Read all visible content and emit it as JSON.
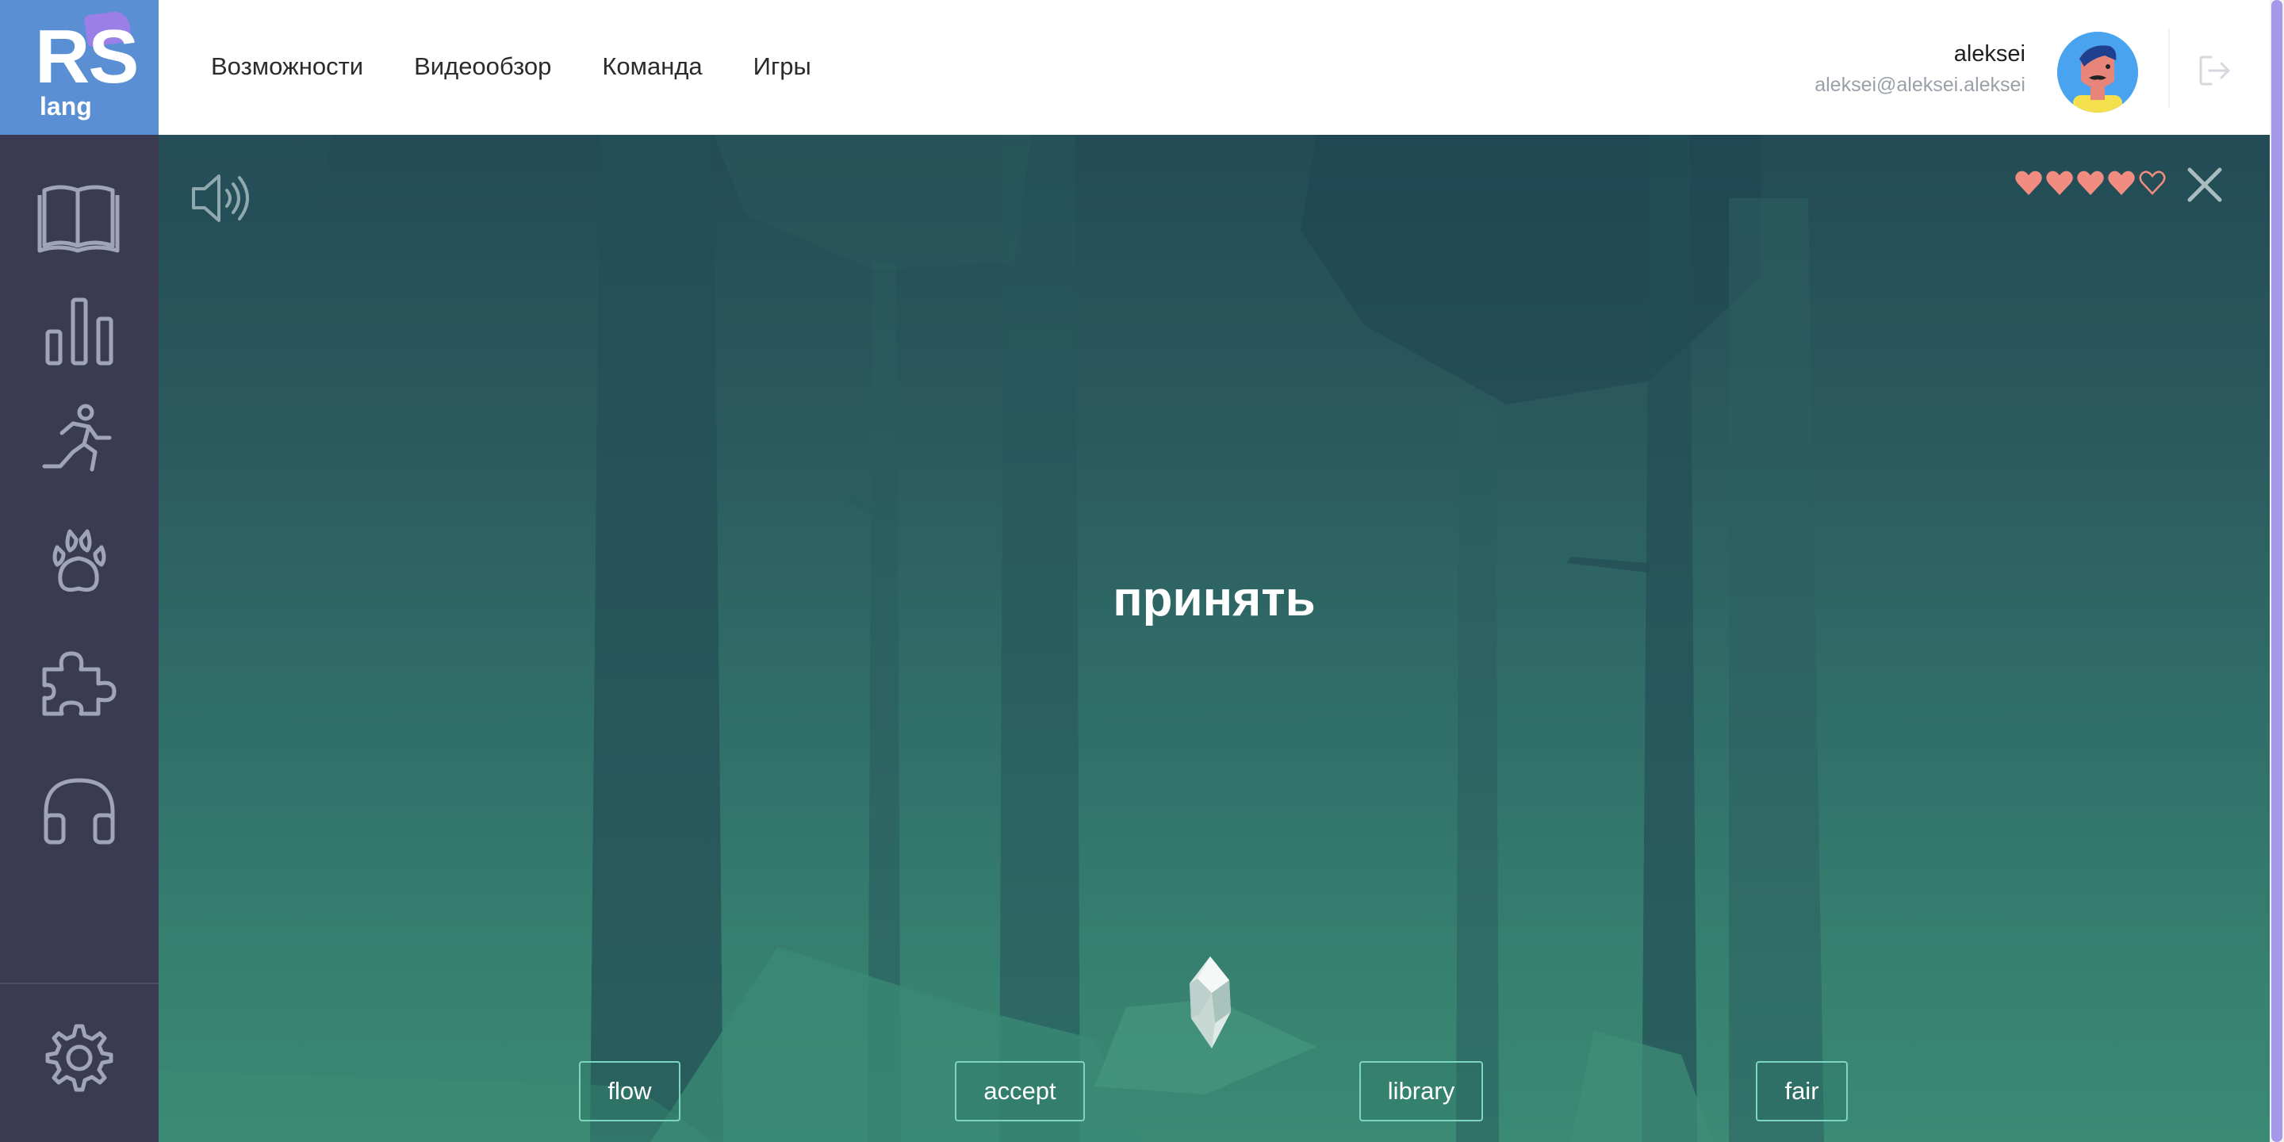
{
  "logo": {
    "main": "RS",
    "sub": "lang"
  },
  "nav": {
    "items": [
      "Возможности",
      "Видеообзор",
      "Команда",
      "Игры"
    ]
  },
  "user": {
    "name": "aleksei",
    "email": "aleksei@aleksei.aleksei"
  },
  "sidebar": {
    "icons": [
      "book-icon",
      "stats-icon",
      "runner-icon",
      "paw-icon",
      "puzzle-icon",
      "headphones-icon",
      "gear-icon"
    ]
  },
  "game": {
    "word": "принять",
    "lives": {
      "filled": 4,
      "total": 5
    },
    "answers": [
      "flow",
      "accept",
      "library",
      "fair"
    ]
  },
  "colors": {
    "logo_bg": "#5a8fd3",
    "sidebar_bg": "#3a3a52",
    "heart": "#f08c80",
    "answer_border": "#7fd6c0",
    "scroll_thumb": "#a598e8"
  }
}
